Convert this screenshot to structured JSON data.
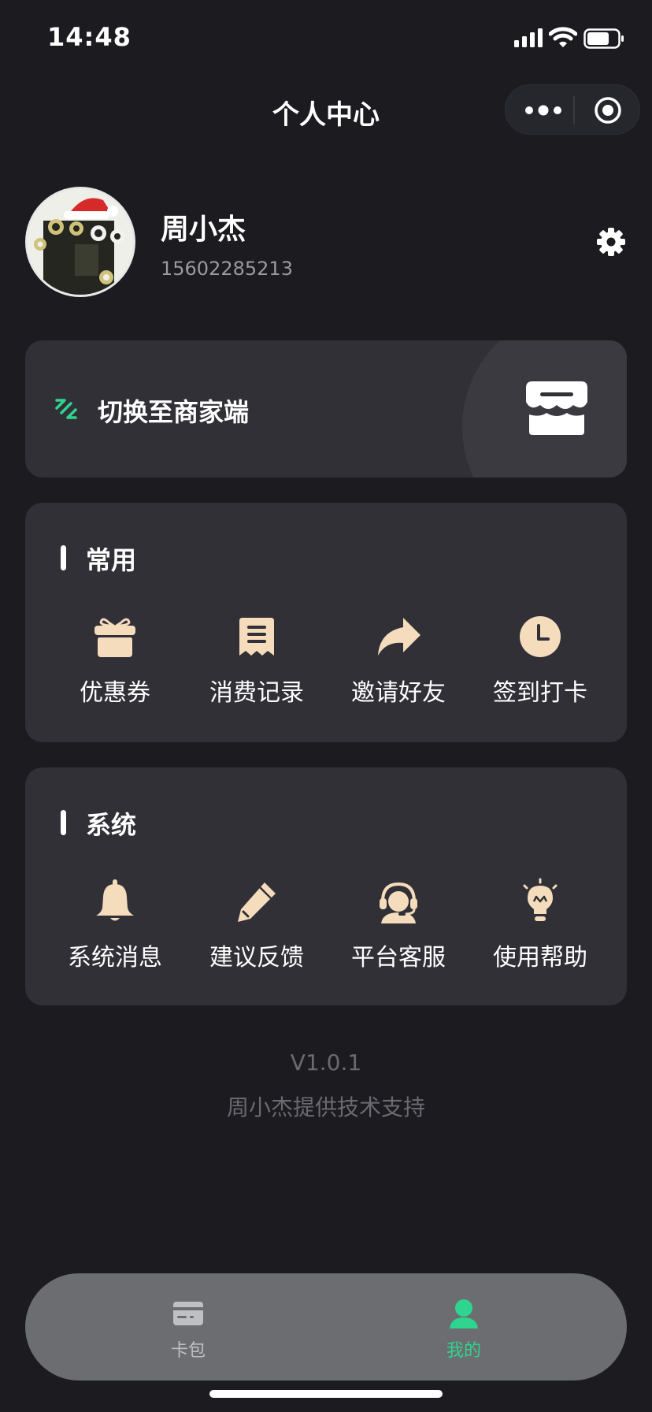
{
  "status_bar": {
    "time": "14:48"
  },
  "header": {
    "title": "个人中心"
  },
  "profile": {
    "name": "周小杰",
    "phone": "15602285213"
  },
  "switch_card": {
    "label": "切换至商家端"
  },
  "common": {
    "title": "常用",
    "items": [
      {
        "label": "优惠券",
        "icon": "gift-icon"
      },
      {
        "label": "消费记录",
        "icon": "receipt-icon"
      },
      {
        "label": "邀请好友",
        "icon": "share-arrow-icon"
      },
      {
        "label": "签到打卡",
        "icon": "clock-icon"
      }
    ]
  },
  "system": {
    "title": "系统",
    "items": [
      {
        "label": "系统消息",
        "icon": "bell-icon"
      },
      {
        "label": "建议反馈",
        "icon": "pencil-icon"
      },
      {
        "label": "平台客服",
        "icon": "headset-icon"
      },
      {
        "label": "使用帮助",
        "icon": "lightbulb-icon"
      }
    ]
  },
  "footer": {
    "version": "V1.0.1",
    "credit": "周小杰提供技术支持"
  },
  "tabbar": {
    "items": [
      {
        "label": "卡包",
        "icon": "card-icon",
        "active": false
      },
      {
        "label": "我的",
        "icon": "user-icon",
        "active": true
      }
    ]
  },
  "colors": {
    "accent": "#2fd58f",
    "icon_gold": "#f4dcbc",
    "card_bg": "#303036",
    "page_bg": "#1b1b20"
  }
}
